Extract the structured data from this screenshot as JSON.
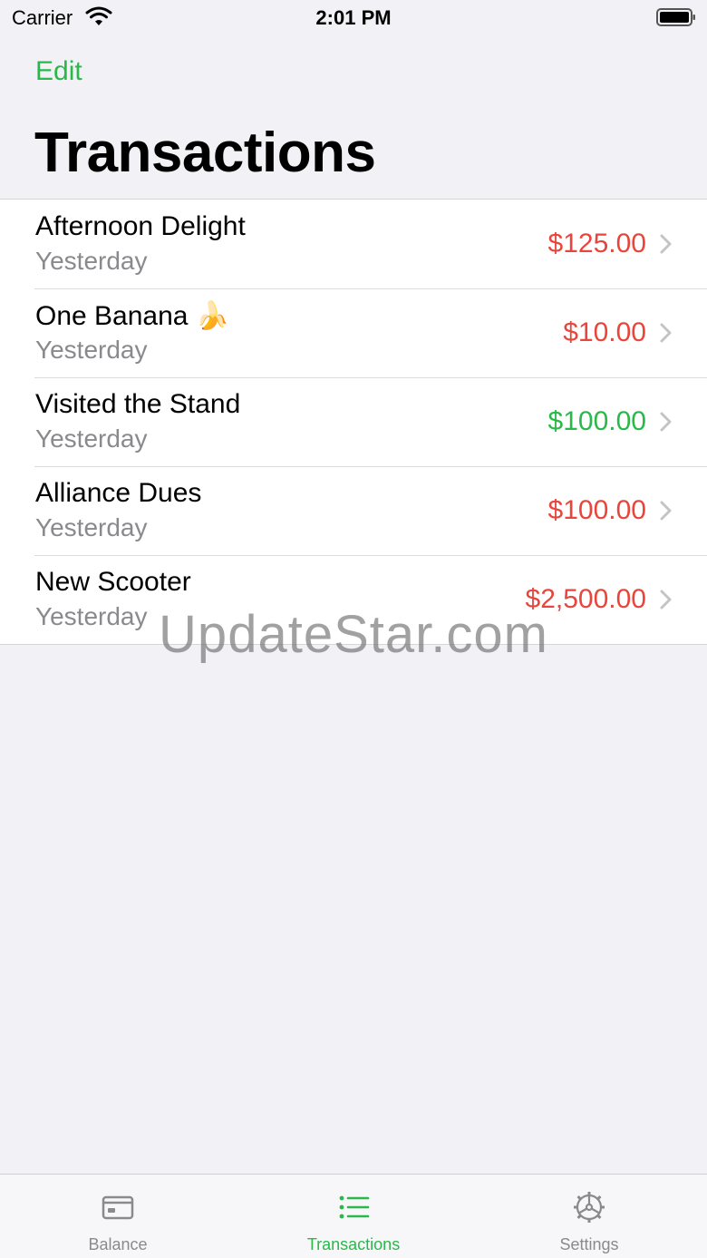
{
  "status_bar": {
    "carrier": "Carrier",
    "time": "2:01 PM"
  },
  "nav": {
    "edit_label": "Edit",
    "title": "Transactions"
  },
  "transactions": [
    {
      "title": "Afternoon Delight",
      "date": "Yesterday",
      "amount": "$125.00",
      "type": "expense"
    },
    {
      "title": "One Banana 🍌",
      "date": "Yesterday",
      "amount": "$10.00",
      "type": "expense"
    },
    {
      "title": "Visited the Stand",
      "date": "Yesterday",
      "amount": "$100.00",
      "type": "income"
    },
    {
      "title": "Alliance Dues",
      "date": "Yesterday",
      "amount": "$100.00",
      "type": "expense"
    },
    {
      "title": "New Scooter",
      "date": "Yesterday",
      "amount": "$2,500.00",
      "type": "expense"
    }
  ],
  "tabs": [
    {
      "label": "Balance",
      "icon": "credit-card-icon",
      "active": false
    },
    {
      "label": "Transactions",
      "icon": "list-icon",
      "active": true
    },
    {
      "label": "Settings",
      "icon": "gear-icon",
      "active": false
    }
  ],
  "watermark": "UpdateStar.com",
  "colors": {
    "accent": "#2ab84a",
    "expense": "#e8453c",
    "income": "#2ab84a",
    "tab_inactive": "#8a8a8e"
  }
}
